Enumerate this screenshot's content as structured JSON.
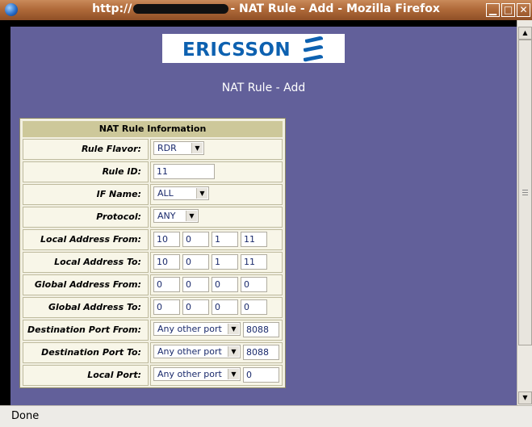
{
  "window": {
    "title_prefix": "http://",
    "title_suffix": "- NAT Rule - Add - Mozilla Firefox",
    "minimize": "▁",
    "maximize": "□",
    "close": "✕"
  },
  "logo": {
    "text": "ERICSSON"
  },
  "page": {
    "heading": "NAT Rule - Add"
  },
  "form": {
    "header": "NAT Rule Information",
    "rule_flavor": {
      "label": "Rule Flavor:",
      "value": "RDR"
    },
    "rule_id": {
      "label": "Rule ID:",
      "value": "11"
    },
    "if_name": {
      "label": "IF Name:",
      "value": "ALL"
    },
    "protocol": {
      "label": "Protocol:",
      "value": "ANY"
    },
    "local_from": {
      "label": "Local Address From:",
      "octets": [
        "10",
        "0",
        "1",
        "11"
      ]
    },
    "local_to": {
      "label": "Local Address To:",
      "octets": [
        "10",
        "0",
        "1",
        "11"
      ]
    },
    "global_from": {
      "label": "Global Address From:",
      "octets": [
        "0",
        "0",
        "0",
        "0"
      ]
    },
    "global_to": {
      "label": "Global Address To:",
      "octets": [
        "0",
        "0",
        "0",
        "0"
      ]
    },
    "dest_port_from": {
      "label": "Destination Port From:",
      "select": "Any other port",
      "value": "8088"
    },
    "dest_port_to": {
      "label": "Destination Port To:",
      "select": "Any other port",
      "value": "8088"
    },
    "local_port": {
      "label": "Local Port:",
      "select": "Any other port",
      "value": "0"
    }
  },
  "statusbar": {
    "text": "Done"
  }
}
